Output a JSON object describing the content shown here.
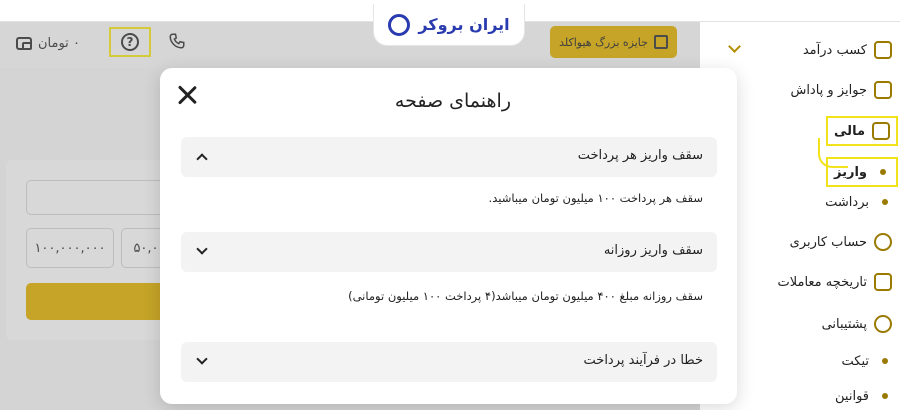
{
  "header": {
    "balance_text": "۰ تومان",
    "prize_button_label": "جایزه بزرگ هیواکلد",
    "icons": {
      "wallet": "wallet-icon",
      "help": "question-circle-icon",
      "phone": "phone-icon",
      "gift": "gift-icon"
    }
  },
  "logo": {
    "text": "ایران بروکر"
  },
  "content": {
    "amount_options": [
      "۱۰۰,۰۰۰,۰۰۰",
      "۵۰,۰"
    ]
  },
  "sidebar": {
    "items": [
      {
        "label": "کسب درآمد",
        "icon": "stack-icon",
        "has_chevron": true
      },
      {
        "label": "جوایز و پاداش",
        "icon": "gift-icon",
        "has_chevron": false
      },
      {
        "label": "مالی",
        "icon": "wallet-icon",
        "has_chevron": false,
        "highlighted": true
      },
      {
        "label": "واریز",
        "sub": true,
        "highlighted": true
      },
      {
        "label": "برداشت",
        "sub": true
      },
      {
        "label": "حساب کاربری",
        "icon": "user-circle-icon",
        "has_chevron": false
      },
      {
        "label": "تاریخچه معاملات",
        "icon": "clipboard-icon",
        "has_chevron": false
      },
      {
        "label": "پشتیبانی",
        "icon": "lifebuoy-icon",
        "has_chevron": false
      },
      {
        "label": "تیکت",
        "sub": true
      },
      {
        "label": "قوانین",
        "sub": true
      }
    ]
  },
  "modal": {
    "title": "راهنمای صفحه",
    "close_icon": "close-icon",
    "sections": [
      {
        "title": "سقف واریز هر پرداخت",
        "expanded": true,
        "body": "سقف هر پرداخت ۱۰۰ میلیون تومان میباشید."
      },
      {
        "title": "سقف واریز روزانه",
        "expanded": false,
        "body": "سقف روزانه مبلغ ۴۰۰ میلیون تومان میباشد(۴ پرداخت ۱۰۰ میلیون تومانی)"
      },
      {
        "title": "خطا در فرآیند پرداخت",
        "expanded": false,
        "body": ""
      }
    ]
  },
  "colors": {
    "accent": "#dcae00",
    "highlight": "#f2e21a",
    "brand": "#2a3bb0"
  }
}
